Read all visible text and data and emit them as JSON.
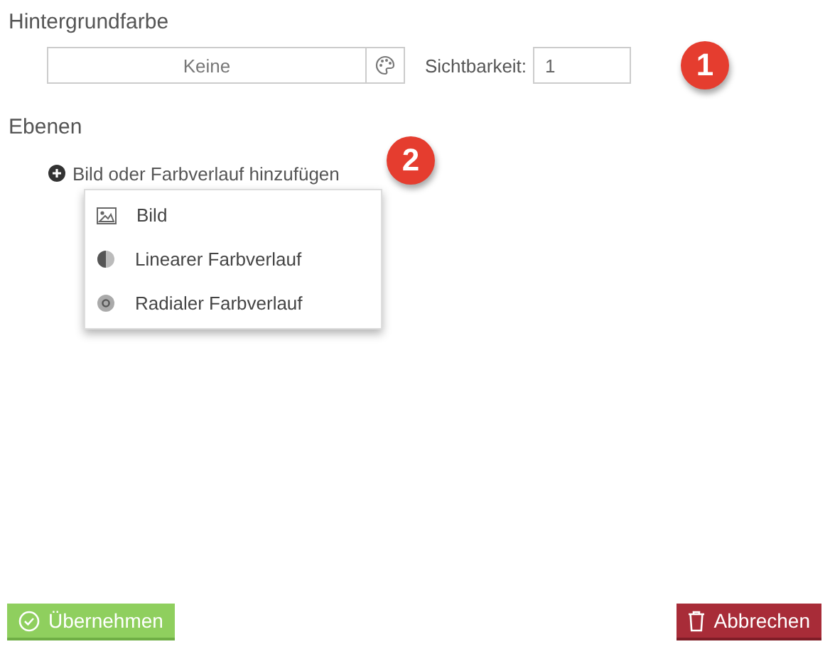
{
  "background_section": {
    "title": "Hintergrundfarbe",
    "color_field": {
      "value": "Keine"
    },
    "visibility": {
      "label": "Sichtbarkeit:",
      "value": "1"
    },
    "callout": "1"
  },
  "layers_section": {
    "title": "Ebenen",
    "add_link": "Bild oder Farbverlauf hinzufügen",
    "callout": "2",
    "menu": [
      {
        "kind": "image",
        "label": "Bild"
      },
      {
        "kind": "linear",
        "label": "Linearer Farbverlauf"
      },
      {
        "kind": "radial",
        "label": "Radialer Farbverlauf"
      }
    ]
  },
  "buttons": [
    {
      "kind": "apply",
      "label": "Übernehmen"
    },
    {
      "kind": "cancel",
      "label": "Abbrechen"
    }
  ]
}
